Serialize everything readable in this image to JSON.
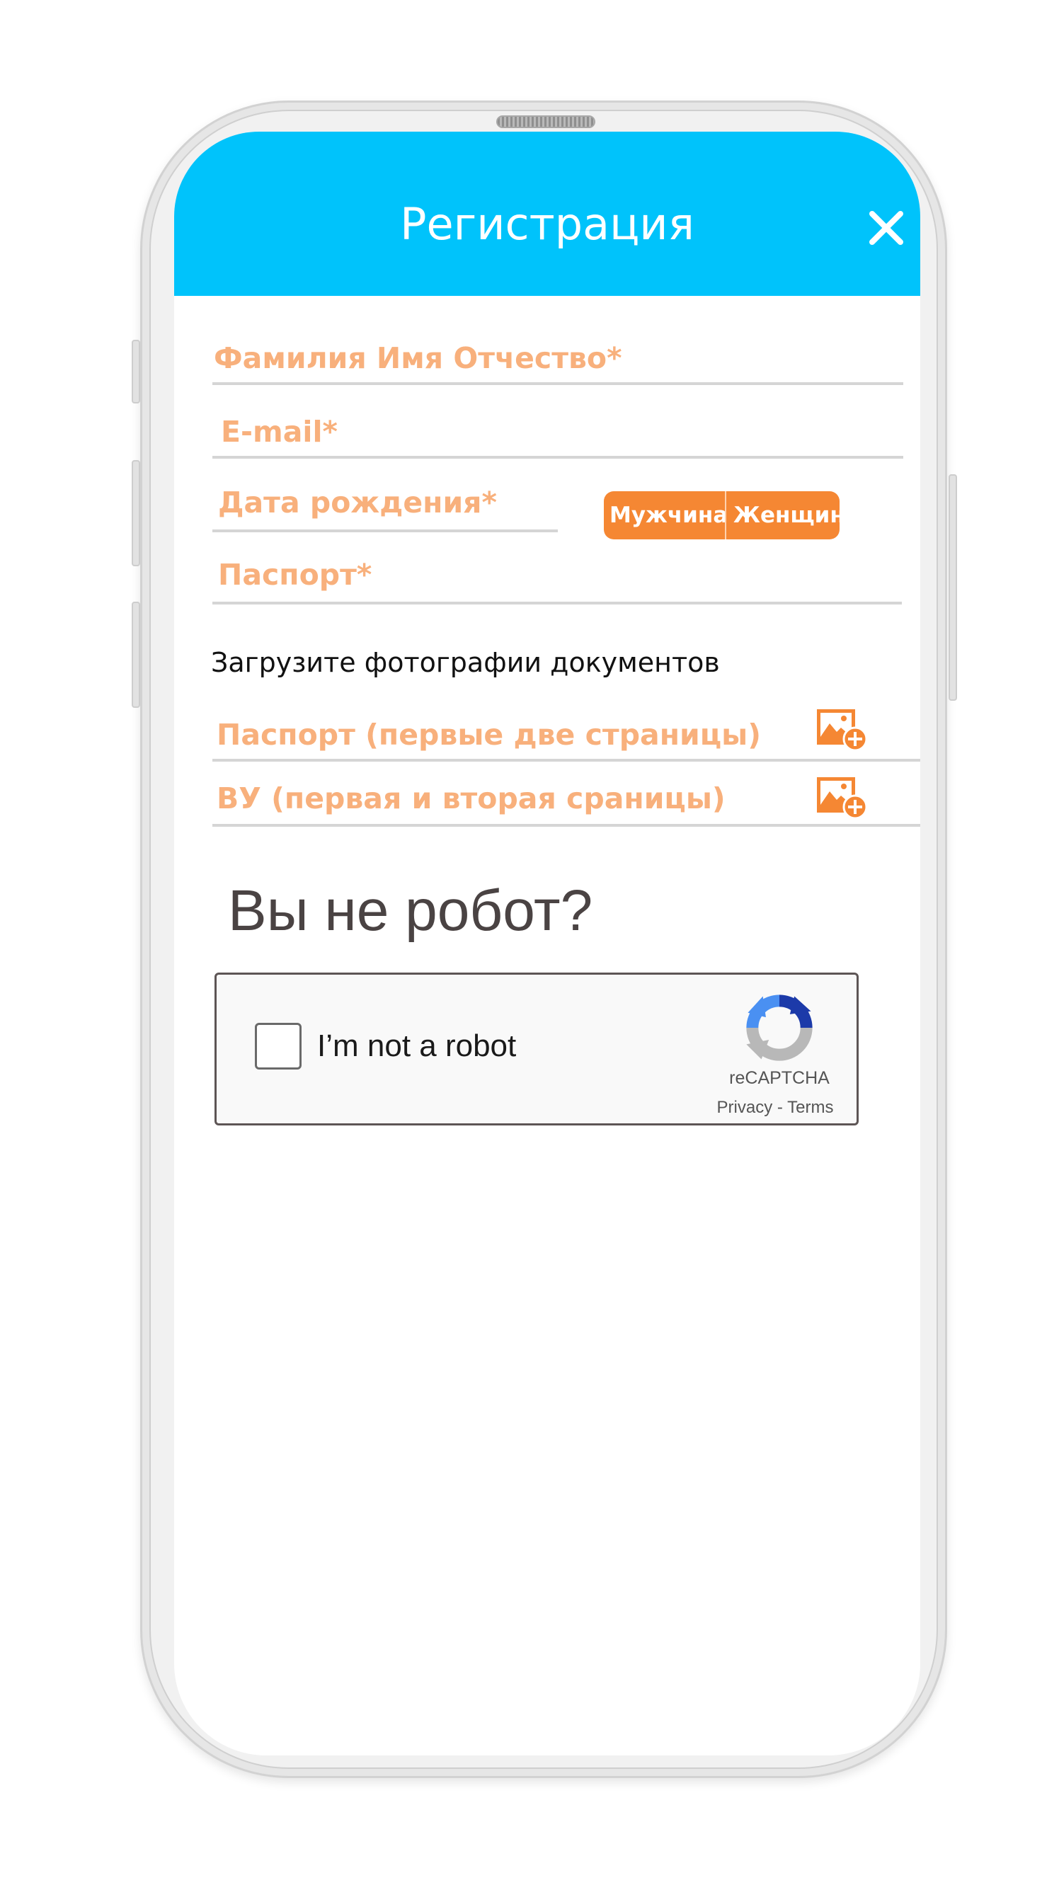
{
  "header": {
    "title": "Регистрация"
  },
  "form": {
    "full_name_label": "Фамилия Имя Отчество*",
    "email_label": "E-mail*",
    "birth_date_label": "Дата рождения*",
    "passport_label": "Паспорт*",
    "gender": {
      "male_label": "Мужчина",
      "female_label": "Женщина"
    }
  },
  "uploads": {
    "heading": "Загрузите фотографии документов",
    "items": [
      {
        "label": "Паспорт (первые две страницы)",
        "icon": "add-image-icon"
      },
      {
        "label": "ВУ (первая и вторая сраницы)",
        "icon": "add-image-icon"
      }
    ]
  },
  "captcha": {
    "heading": "Вы не робот?",
    "checkbox_label": "I’m not a robot",
    "brand": "reCAPTCHA",
    "privacy_label": "Privacy",
    "separator": " - ",
    "terms_label": "Terms"
  },
  "colors": {
    "header_bg": "#00c3fb",
    "field_label": "#f8b07c",
    "toggle_bg": "#f58733",
    "upload_icon": "#f58733"
  }
}
